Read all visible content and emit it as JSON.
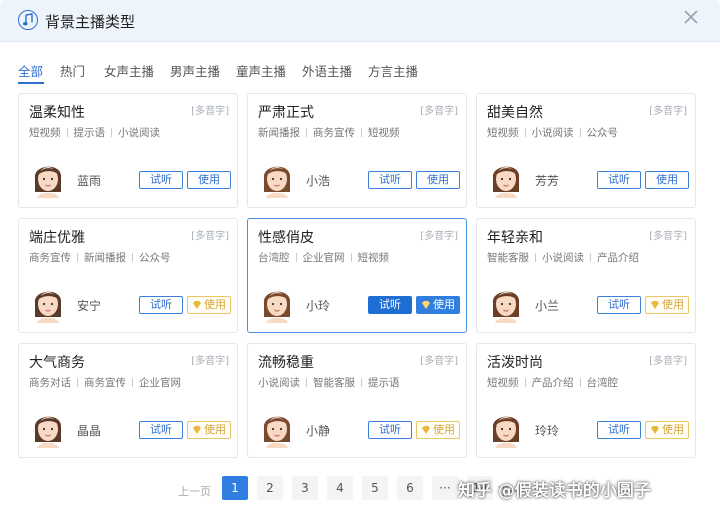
{
  "dialog": {
    "title": "背景主播类型"
  },
  "tabs": [
    "全部",
    "热门",
    "女声主播",
    "男声主播",
    "童声主播",
    "外语主播",
    "方言主播"
  ],
  "multi_tag": "[多音字]",
  "try_label": "试听",
  "use_label": "使用",
  "cards": [
    {
      "title": "温柔知性",
      "tags": [
        "短视频",
        "提示语",
        "小说阅读"
      ],
      "voice": "蓝雨",
      "vip": false
    },
    {
      "title": "严肃正式",
      "tags": [
        "新闻播报",
        "商务宣传",
        "短视频"
      ],
      "voice": "小浩",
      "vip": false
    },
    {
      "title": "甜美自然",
      "tags": [
        "短视频",
        "小说阅读",
        "公众号"
      ],
      "voice": "芳芳",
      "vip": false
    },
    {
      "title": "端庄优雅",
      "tags": [
        "商务宣传",
        "新闻播报",
        "公众号"
      ],
      "voice": "安宁",
      "vip": true
    },
    {
      "title": "性感俏皮",
      "tags": [
        "台湾腔",
        "企业官网",
        "短视频"
      ],
      "voice": "小玲",
      "vip": true,
      "selected": true
    },
    {
      "title": "年轻亲和",
      "tags": [
        "智能客服",
        "小说阅读",
        "产品介绍"
      ],
      "voice": "小兰",
      "vip": true
    },
    {
      "title": "大气商务",
      "tags": [
        "商务对话",
        "商务宣传",
        "企业官网"
      ],
      "voice": "晶晶",
      "vip": true
    },
    {
      "title": "流畅稳重",
      "tags": [
        "小说阅读",
        "智能客服",
        "提示语"
      ],
      "voice": "小静",
      "vip": true
    },
    {
      "title": "活泼时尚",
      "tags": [
        "短视频",
        "产品介绍",
        "台湾腔"
      ],
      "voice": "玲玲",
      "vip": true
    }
  ],
  "pagination": {
    "prev": "上一页",
    "pages": [
      "1",
      "2",
      "3",
      "4",
      "5",
      "6",
      "···"
    ],
    "last": "14",
    "next": "下一",
    "current": "1"
  },
  "watermark": "知乎 @假装读书的小圆子",
  "colors": {
    "accent": "#2f7ee0",
    "vip": "#d4a63a",
    "border": "#e3e6ea"
  }
}
